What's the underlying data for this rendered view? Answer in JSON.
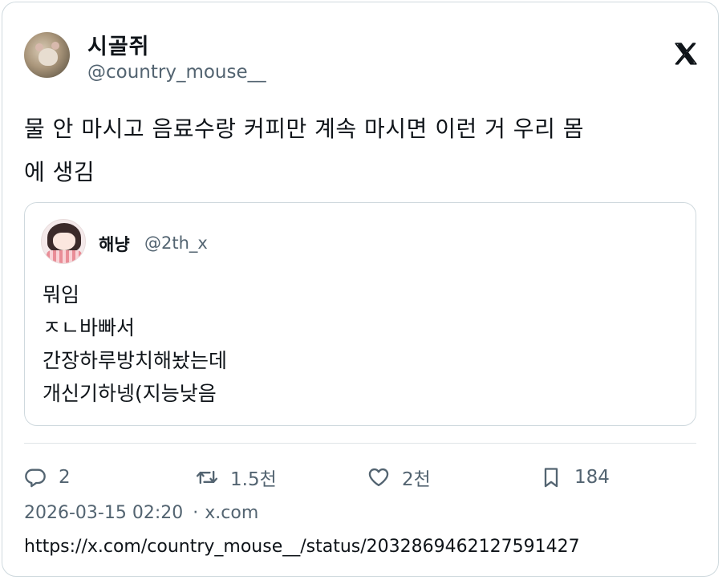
{
  "author": {
    "display_name": "시골쥐",
    "handle": "@country_mouse__"
  },
  "tweet": {
    "text_line1": "물 안 마시고 음료수랑 커피만 계속 마시면 이런 거 우리 몸",
    "text_line2": "에 생김"
  },
  "quoted_tweet": {
    "display_name": "해냥",
    "handle": "@2th_x",
    "lines": [
      "뭐임",
      "ㅈㄴ바빠서",
      "간장하루방치해놨는데",
      "개신기하넹(지능낮음"
    ]
  },
  "actions": {
    "replies": "2",
    "reposts": "1.5천",
    "likes": "2천",
    "bookmarks": "184"
  },
  "meta": {
    "timestamp": "2026-03-15 02:20",
    "separator": "·",
    "source": "x.com"
  },
  "url": "https://x.com/country_mouse__/status/2032869462127591427",
  "colors": {
    "text": "#0f1419",
    "secondary": "#536471",
    "border": "#cfd9de"
  },
  "icons": [
    "x-logo-icon",
    "reply-icon",
    "repost-icon",
    "like-icon",
    "bookmark-icon"
  ]
}
